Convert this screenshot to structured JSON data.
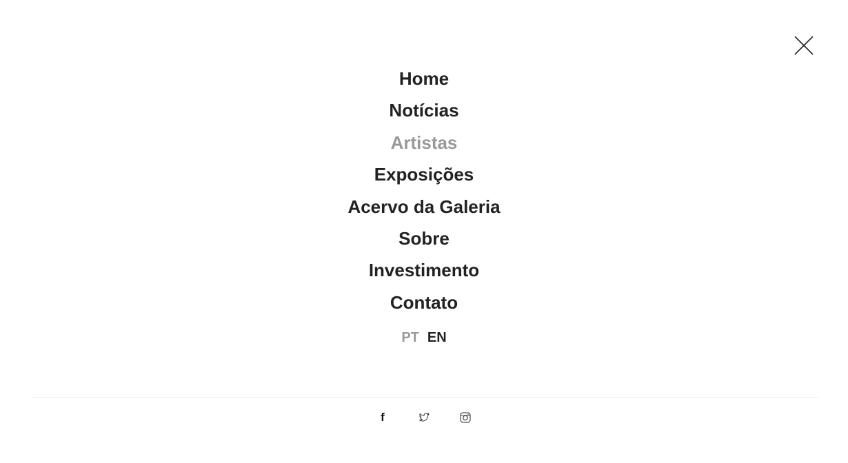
{
  "close": {
    "icon": "close-icon"
  },
  "menu": {
    "items": [
      {
        "label": "Home"
      },
      {
        "label": "Notícias"
      },
      {
        "label": "Artistas"
      },
      {
        "label": "Exposições"
      },
      {
        "label": "Acervo da Galeria"
      },
      {
        "label": "Sobre"
      },
      {
        "label": "Investimento"
      },
      {
        "label": "Contato"
      }
    ],
    "active_item": "Artistas"
  },
  "languages": {
    "pt": "PT",
    "en": "EN",
    "active": "PT"
  },
  "social": {
    "facebook": {
      "glyph": "f",
      "icon": "facebook-icon"
    },
    "twitter": {
      "icon": "twitter-icon"
    },
    "instagram": {
      "icon": "instagram-icon"
    }
  },
  "colors": {
    "text": "#222222",
    "muted": "#999999",
    "divider": "#ececec",
    "background": "#ffffff"
  }
}
